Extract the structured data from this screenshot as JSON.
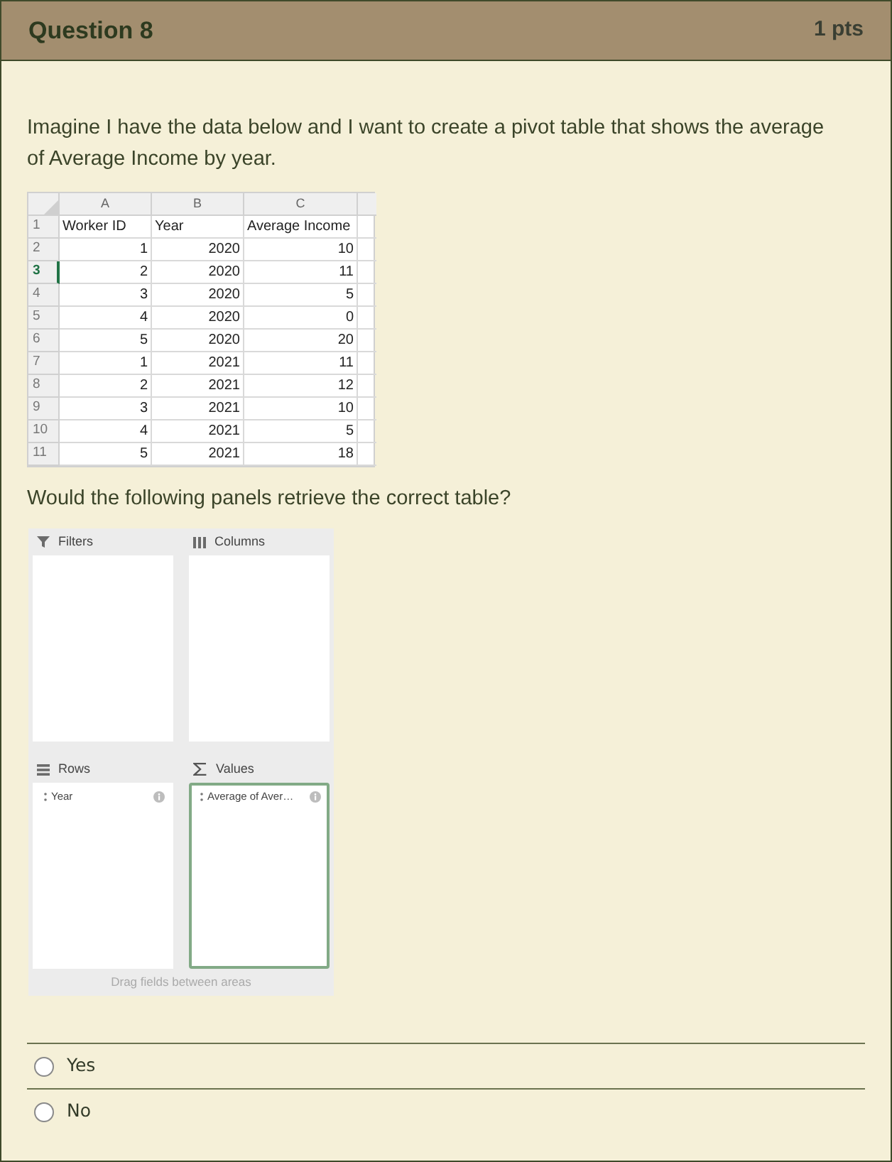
{
  "question": {
    "title": "Question 8",
    "points": "1 pts"
  },
  "prompt": "Imagine I have the data below and I want to create a pivot table that shows the average of Average Income by year.",
  "spreadsheet": {
    "column_letters": [
      "A",
      "B",
      "C"
    ],
    "rows": [
      {
        "number": "1",
        "kind": "header",
        "selected": false,
        "cells": [
          "Worker ID",
          "Year",
          "Average Income"
        ]
      },
      {
        "number": "2",
        "kind": "data",
        "selected": false,
        "cells": [
          "1",
          "2020",
          "10"
        ]
      },
      {
        "number": "3",
        "kind": "data",
        "selected": true,
        "cells": [
          "2",
          "2020",
          "11"
        ]
      },
      {
        "number": "4",
        "kind": "data",
        "selected": false,
        "cells": [
          "3",
          "2020",
          "5"
        ]
      },
      {
        "number": "5",
        "kind": "data",
        "selected": false,
        "cells": [
          "4",
          "2020",
          "0"
        ]
      },
      {
        "number": "6",
        "kind": "data",
        "selected": false,
        "cells": [
          "5",
          "2020",
          "20"
        ]
      },
      {
        "number": "7",
        "kind": "data",
        "selected": false,
        "cells": [
          "1",
          "2021",
          "11"
        ]
      },
      {
        "number": "8",
        "kind": "data",
        "selected": false,
        "cells": [
          "2",
          "2021",
          "12"
        ]
      },
      {
        "number": "9",
        "kind": "data",
        "selected": false,
        "cells": [
          "3",
          "2021",
          "10"
        ]
      },
      {
        "number": "10",
        "kind": "data",
        "selected": false,
        "cells": [
          "4",
          "2021",
          "5"
        ]
      },
      {
        "number": "11",
        "kind": "data",
        "selected": false,
        "cells": [
          "5",
          "2021",
          "18"
        ]
      }
    ]
  },
  "follow_up": "Would the following panels retrieve the correct table?",
  "pivot_panel": {
    "areas": [
      {
        "kind": "filters",
        "label": "Filters",
        "selected": false
      },
      {
        "kind": "columns",
        "label": "Columns",
        "selected": false
      },
      {
        "kind": "rows",
        "label": "Rows",
        "selected": false,
        "fields": [
          "Year"
        ]
      },
      {
        "kind": "values",
        "label": "Values",
        "selected": true,
        "fields": [
          "Average of Aver…"
        ]
      }
    ],
    "footer": "Drag fields between areas"
  },
  "answers": [
    {
      "label": "Yes",
      "selected": false
    },
    {
      "label": "No",
      "selected": false
    }
  ]
}
